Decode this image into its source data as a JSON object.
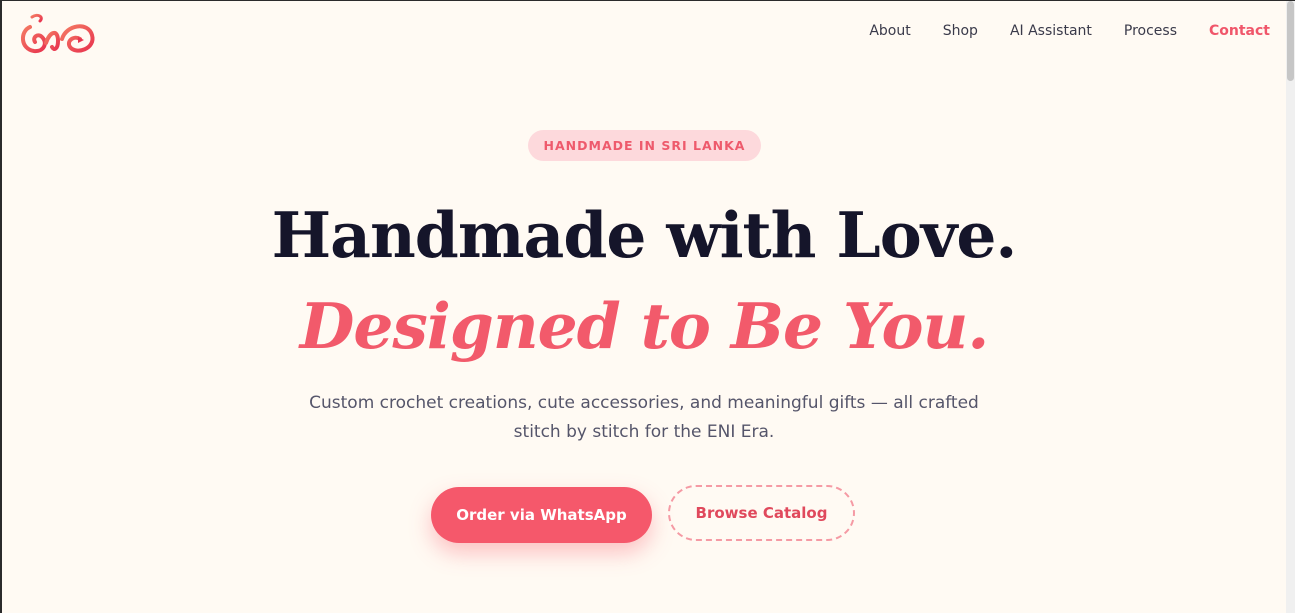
{
  "brand": {
    "logo_icon": "eni-logo-icon",
    "accent_color": "#f25a6b"
  },
  "nav": {
    "items": [
      {
        "label": "About"
      },
      {
        "label": "Shop"
      },
      {
        "label": "AI Assistant"
      },
      {
        "label": "Process"
      },
      {
        "label": "Contact",
        "active": true
      }
    ]
  },
  "hero": {
    "badge": "HANDMADE IN SRI LANKA",
    "headline": "Handmade with Love.",
    "headline_accent": "Designed to Be You.",
    "subtext": "Custom crochet creations, cute accessories, and meaningful gifts — all crafted stitch by stitch for the ENI Era.",
    "primary_cta": "Order via WhatsApp",
    "secondary_cta": "Browse Catalog"
  }
}
